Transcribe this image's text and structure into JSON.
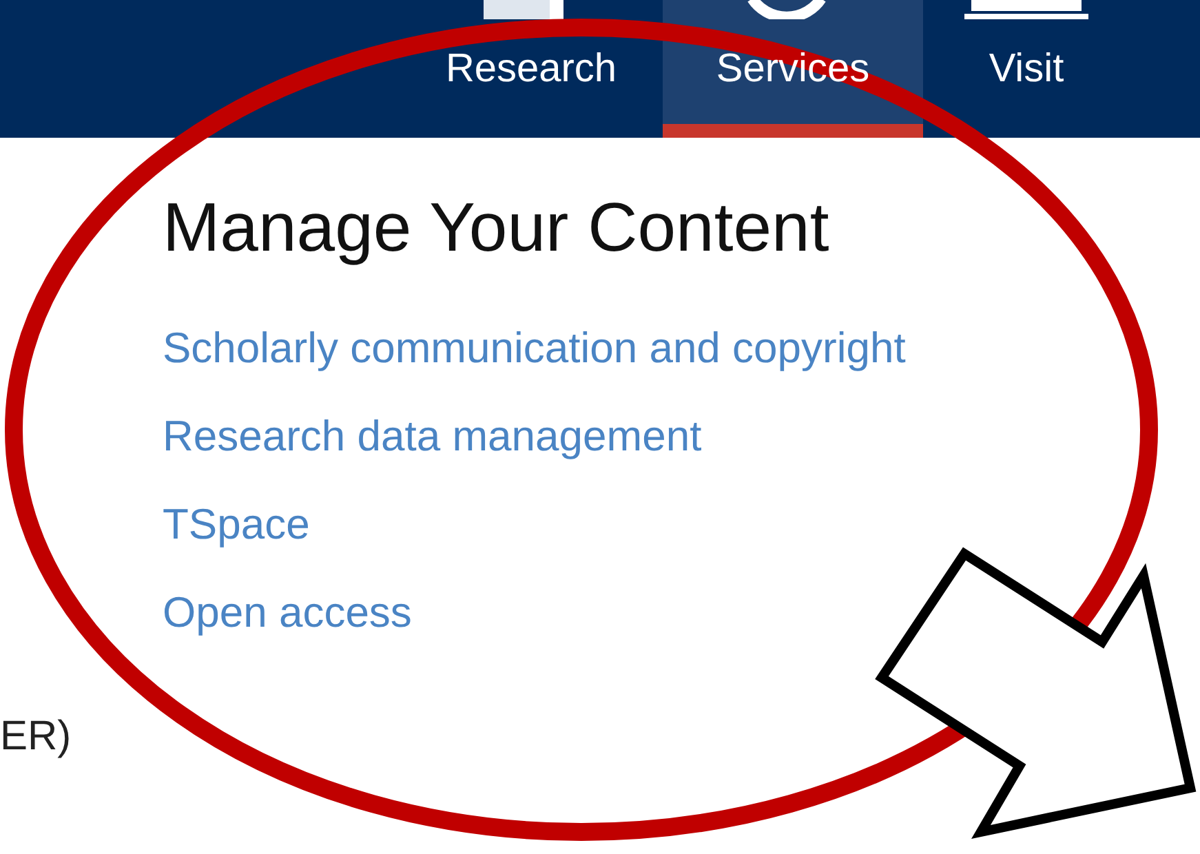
{
  "nav": [
    {
      "label": "Research",
      "selected": false
    },
    {
      "label": "Services",
      "selected": true
    },
    {
      "label": "Visit",
      "selected": false
    }
  ],
  "heading": "Manage Your Content",
  "links": [
    "Scholarly communication and copyright",
    "Research data management",
    "TSpace",
    "Open access"
  ],
  "side_text": "ER)"
}
